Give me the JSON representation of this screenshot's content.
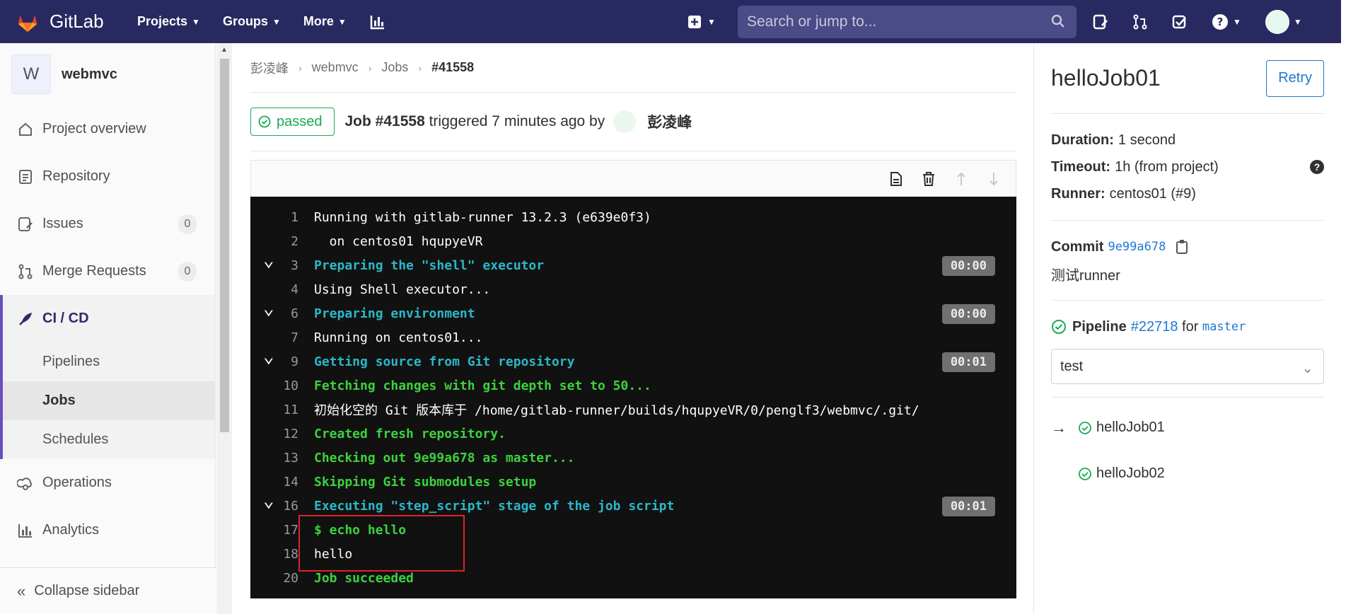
{
  "nav": {
    "brand": "GitLab",
    "items": [
      {
        "label": "Projects"
      },
      {
        "label": "Groups"
      },
      {
        "label": "More"
      }
    ],
    "search_placeholder": "Search or jump to..."
  },
  "sidebar": {
    "project_initial": "W",
    "project_name": "webmvc",
    "items": [
      {
        "label": "Project overview"
      },
      {
        "label": "Repository"
      },
      {
        "label": "Issues",
        "count": "0"
      },
      {
        "label": "Merge Requests",
        "count": "0"
      },
      {
        "label": "CI / CD"
      },
      {
        "label": "Operations"
      },
      {
        "label": "Analytics"
      }
    ],
    "cicd_sub": [
      {
        "label": "Pipelines"
      },
      {
        "label": "Jobs"
      },
      {
        "label": "Schedules"
      }
    ],
    "collapse": "Collapse sidebar"
  },
  "breadcrumb": [
    "彭凌峰",
    "webmvc",
    "Jobs",
    "#41558"
  ],
  "job": {
    "status": "passed",
    "title": "Job #41558",
    "triggered": "triggered 7 minutes ago by",
    "user": "彭凌峰"
  },
  "log": [
    {
      "n": "1",
      "t": "Running with gitlab-runner 13.2.3 (e639e0f3)",
      "c": "white"
    },
    {
      "n": "2",
      "t": "  on centos01 hqupyeVR",
      "c": "white"
    },
    {
      "n": "3",
      "t": "Preparing the \"shell\" executor",
      "c": "cyan",
      "section": true,
      "dur": "00:00"
    },
    {
      "n": "4",
      "t": "Using Shell executor...",
      "c": "white"
    },
    {
      "n": "6",
      "t": "Preparing environment",
      "c": "cyan",
      "section": true,
      "dur": "00:00"
    },
    {
      "n": "7",
      "t": "Running on centos01...",
      "c": "white"
    },
    {
      "n": "9",
      "t": "Getting source from Git repository",
      "c": "cyan",
      "section": true,
      "dur": "00:01"
    },
    {
      "n": "10",
      "t": "Fetching changes with git depth set to 50...",
      "c": "green"
    },
    {
      "n": "11",
      "t": "初始化空的 Git 版本库于 /home/gitlab-runner/builds/hqupyeVR/0/penglf3/webmvc/.git/",
      "c": "white"
    },
    {
      "n": "12",
      "t": "Created fresh repository.",
      "c": "green"
    },
    {
      "n": "13",
      "t": "Checking out 9e99a678 as master...",
      "c": "green"
    },
    {
      "n": "14",
      "t": "Skipping Git submodules setup",
      "c": "green"
    },
    {
      "n": "16",
      "t": "Executing \"step_script\" stage of the job script",
      "c": "cyan",
      "section": true,
      "dur": "00:01"
    },
    {
      "n": "17",
      "t": "$ echo hello",
      "c": "green"
    },
    {
      "n": "18",
      "t": "hello",
      "c": "white"
    },
    {
      "n": "20",
      "t": "Job succeeded",
      "c": "green"
    }
  ],
  "right": {
    "title": "helloJob01",
    "retry": "Retry",
    "duration_label": "Duration:",
    "duration": "1 second",
    "timeout_label": "Timeout:",
    "timeout": "1h (from project)",
    "runner_label": "Runner:",
    "runner": "centos01 (#9)",
    "commit_label": "Commit",
    "commit": "9e99a678",
    "commit_msg": "测试runner",
    "pipeline_label": "Pipeline",
    "pipeline": "#22718",
    "for": "for",
    "branch": "master",
    "stage": "test",
    "jobs": [
      "helloJob01",
      "helloJob02"
    ]
  },
  "colors": {
    "nav": "#292961",
    "passed": "#1aaa55",
    "link": "#1f78d1",
    "highlight": "#e0212a"
  }
}
